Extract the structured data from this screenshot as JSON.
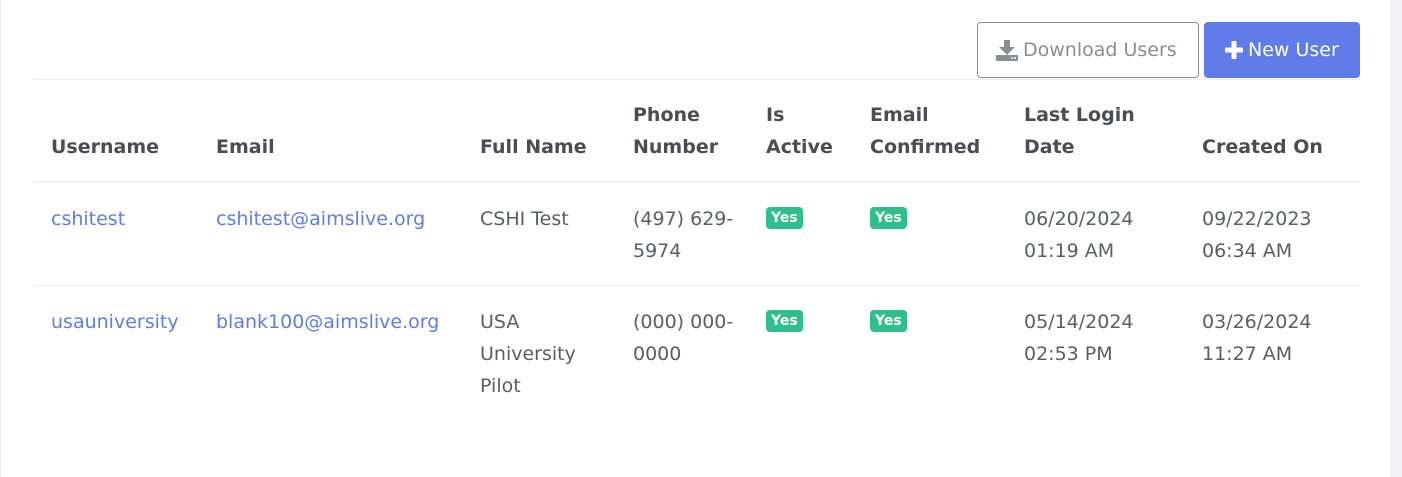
{
  "toolbar": {
    "download_label": "Download Users",
    "download_icon": "download-icon",
    "new_label": "New User",
    "new_icon": "plus-icon",
    "accent_color": "#5f7ce9"
  },
  "table": {
    "headers": {
      "username": "Username",
      "email": "Email",
      "full_name": "Full Name",
      "phone": "Phone Number",
      "is_active": "Is Active",
      "email_confirmed": "Email Confirmed",
      "last_login": "Last Login Date",
      "created_on": "Created On"
    },
    "rows": [
      {
        "username": "cshitest",
        "email": "cshitest@aimslive.org",
        "full_name": "CSHI Test",
        "phone": "(497) 629-5974",
        "is_active": "Yes",
        "email_confirmed": "Yes",
        "last_login": "06/20/2024 01:19 AM",
        "created_on": "09/22/2023 06:34 AM"
      },
      {
        "username": "usauniversity",
        "email": "blank100@aimslive.org",
        "full_name": "USA University Pilot",
        "phone": "(000) 000-0000",
        "is_active": "Yes",
        "email_confirmed": "Yes",
        "last_login": "05/14/2024 02:53 PM",
        "created_on": "03/26/2024 11:27 AM"
      }
    ],
    "badge_color": "#2fbf8a"
  }
}
